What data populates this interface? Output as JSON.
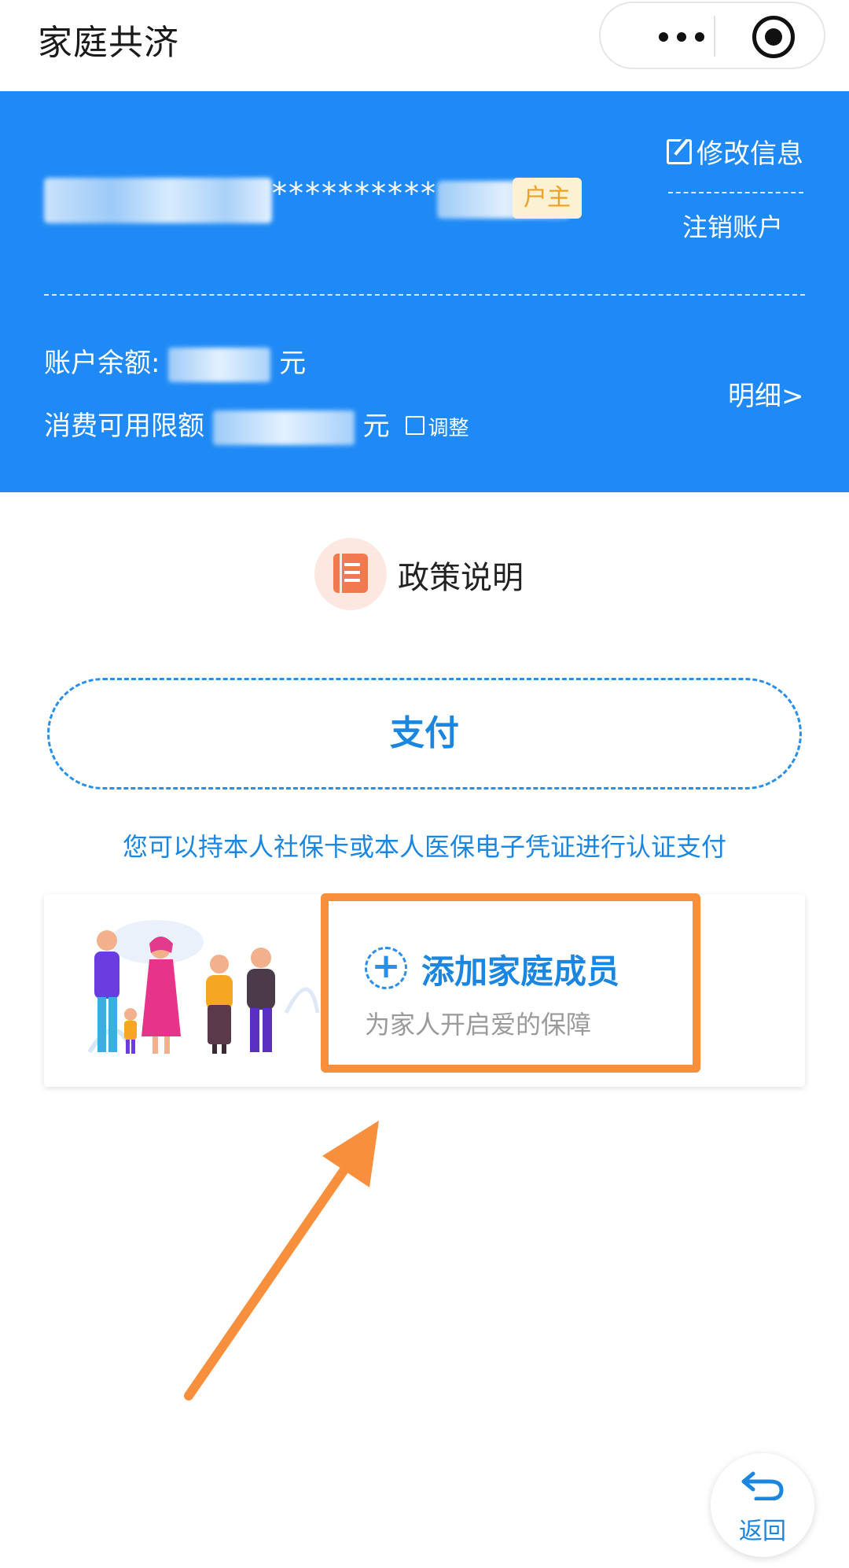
{
  "header": {
    "title": "家庭共济",
    "more_icon": "more-dots-icon",
    "close_icon": "target-close-icon"
  },
  "account": {
    "masked_id": "**********",
    "owner_badge": "户主",
    "edit_info": "修改信息",
    "logout": "注销账户",
    "balance_label": "账户余额:",
    "balance_unit": "元",
    "limit_label": "消费可用限额",
    "limit_unit": "元",
    "adjust": "调整",
    "details": "明细>"
  },
  "policy": {
    "label": "政策说明",
    "icon": "policy-document-icon"
  },
  "payment": {
    "button": "支付",
    "hint": "您可以持本人社保卡或本人医保电子凭证进行认证支付"
  },
  "family": {
    "add_title": "添加家庭成员",
    "add_subtitle": "为家人开启爱的保障"
  },
  "footer": {
    "back": "返回"
  },
  "colors": {
    "primary_blue": "#1f8af5",
    "link_blue": "#1a86e0",
    "highlight_orange": "#f78f3c",
    "badge_bg": "#fdf1d3",
    "badge_text": "#f0a020"
  }
}
